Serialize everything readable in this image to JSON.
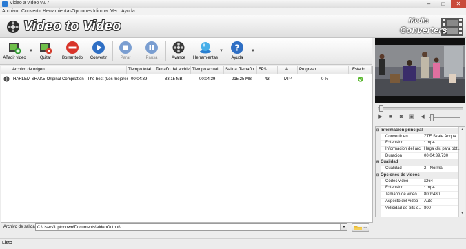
{
  "window": {
    "title": "Video a video v2.7",
    "controls": [
      "–",
      "□",
      "✕"
    ]
  },
  "menu": [
    "Archivo",
    "Convertir",
    "Herramientas",
    "Opciones",
    "Idioma",
    "Ver",
    "Ayuda"
  ],
  "header": {
    "app_name": "Video to Video",
    "brand_line1": "Media",
    "brand_line2": "Converters"
  },
  "toolbar": {
    "add_video": "Añadir video",
    "remove": "Quitar",
    "clear_all": "Borrar todo",
    "convert": "Convertir",
    "stop": "Parar",
    "pause": "Pausa",
    "progress": "Avance",
    "tools": "Herramientas",
    "help": "Ayuda",
    "dropdown_arrow": "▼"
  },
  "table": {
    "columns": [
      "Archivo de origen",
      "Tiempo total",
      "Tamaño del archivo",
      "Tiempo actual",
      "Salida. Tamaño",
      "FPS",
      "A",
      "Progreso",
      "Estado"
    ],
    "rows": [
      {
        "file": "HARLEM SHAKE Original Compilation - The best (Los mejores vi...",
        "total_time": "00:04:39",
        "file_size": "83.15 MB",
        "current_time": "00:04:39",
        "output_size": "215.25 MB",
        "fps": "43",
        "format": "MP4",
        "progress": "0 %",
        "status_icon": "check-circle-icon"
      }
    ]
  },
  "output": {
    "label": "Archivo de salida",
    "path": "C:\\Users\\Uptodown\\Documents\\VideoOutput\\"
  },
  "properties": {
    "groups": [
      {
        "name": "Informacion principal",
        "rows": [
          {
            "key": "Convertir en",
            "value": "ZTE Skate Acqua ..."
          },
          {
            "key": "Extension",
            "value": "*.mp4"
          },
          {
            "key": "Informacion del arc...",
            "value": "Haga clic para obt..."
          },
          {
            "key": "Duracion",
            "value": "00:04:39.730"
          }
        ]
      },
      {
        "name": "Cualidad",
        "rows": [
          {
            "key": "Cualidad",
            "value": "2 - Normal"
          }
        ]
      },
      {
        "name": "Opciones de videos",
        "rows": [
          {
            "key": "Codec video",
            "value": "x264"
          },
          {
            "key": "Extension",
            "value": "*.mp4"
          },
          {
            "key": "Tamaño de video",
            "value": "800x480"
          },
          {
            "key": "Aspecto del video",
            "value": "Auto"
          },
          {
            "key": "Velicidad de bits d...",
            "value": "800"
          }
        ]
      }
    ]
  },
  "status": {
    "text": "Listo"
  }
}
